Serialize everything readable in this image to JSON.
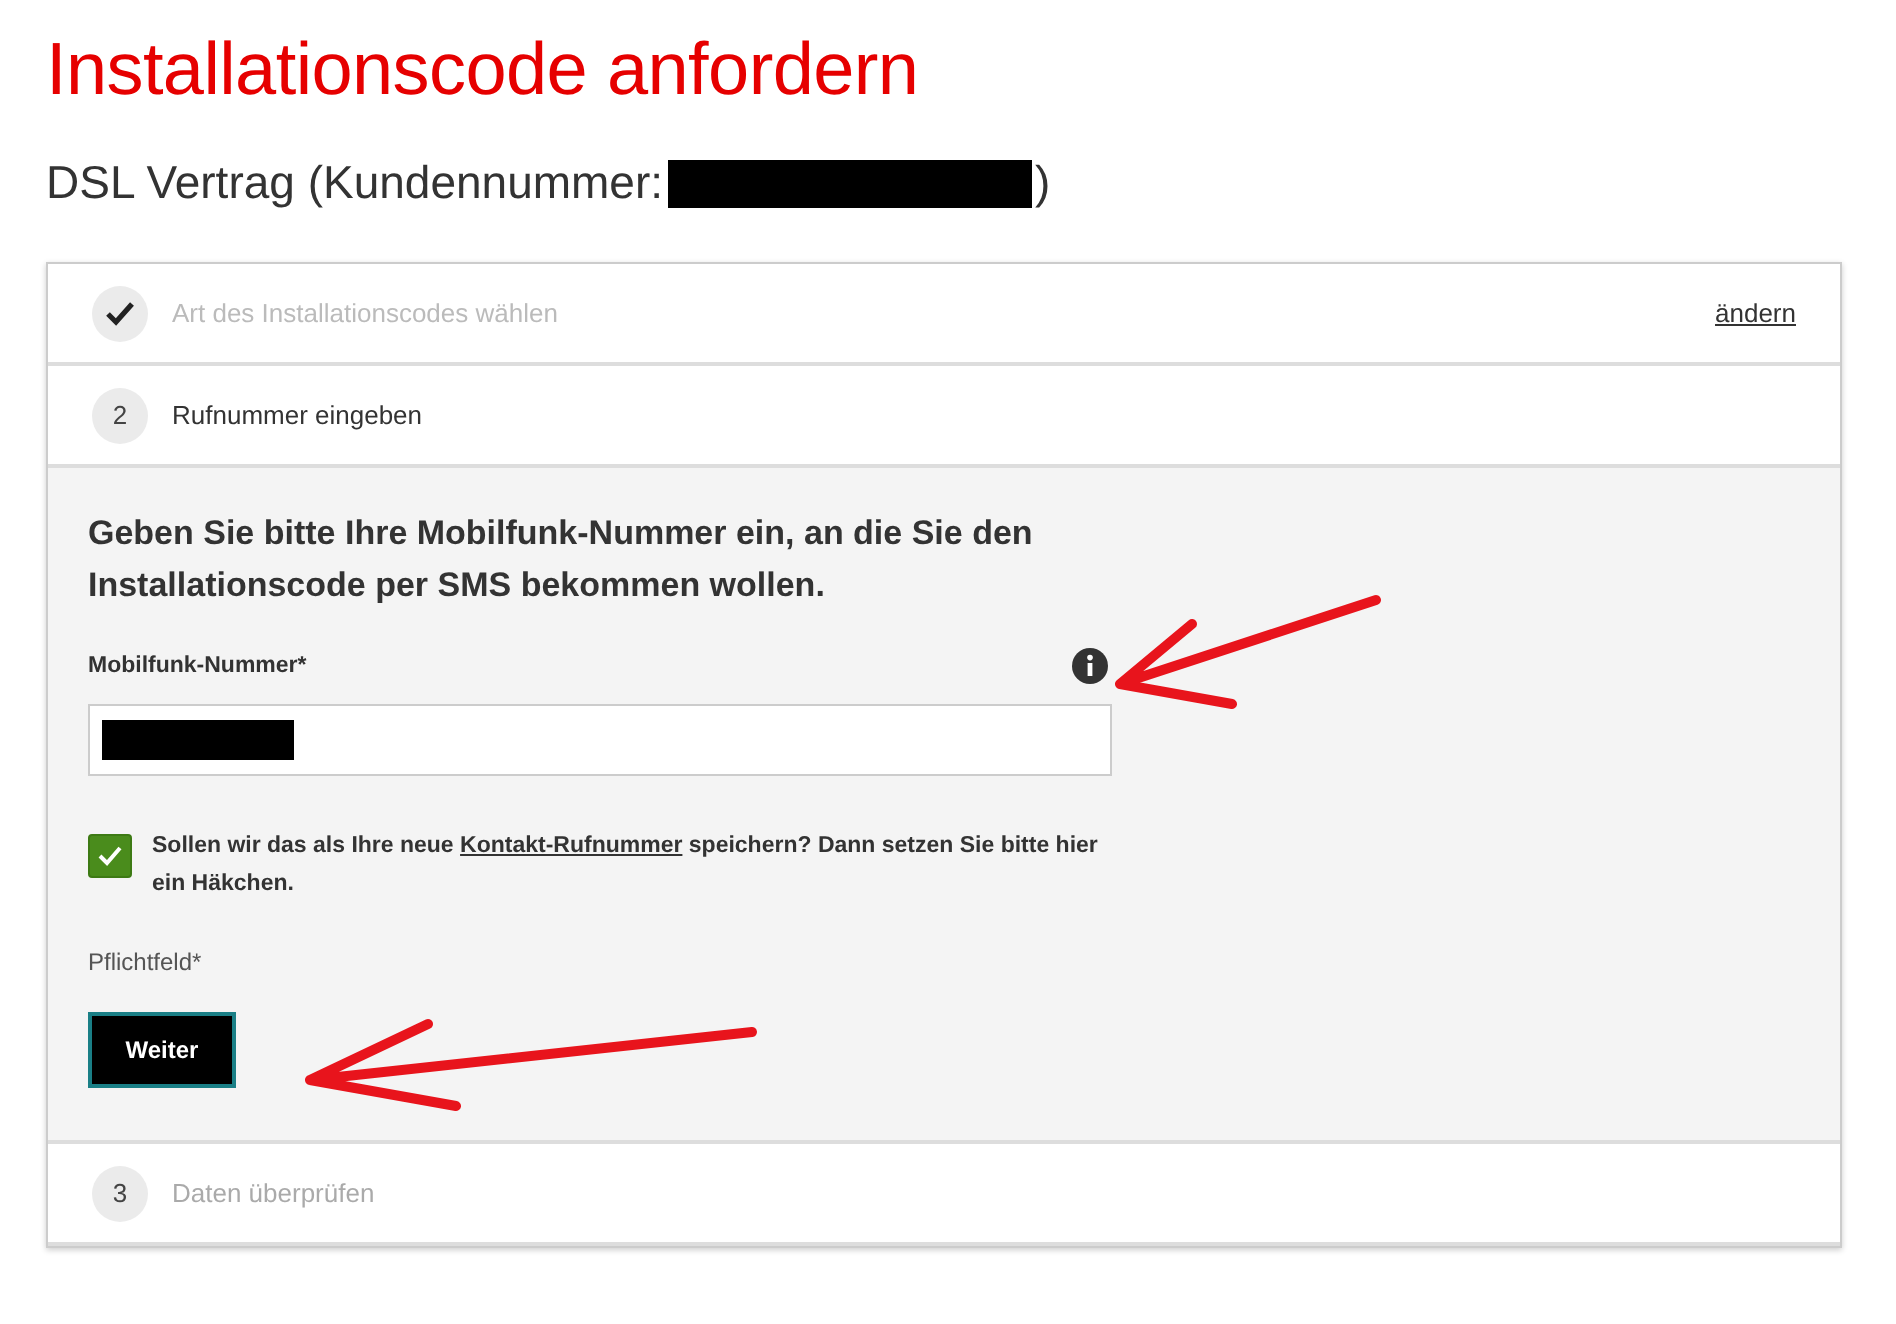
{
  "title": "Installationscode anfordern",
  "subtitle": {
    "text": "DSL Vertrag (Kundennummer:",
    "closing": ")",
    "redacted": true
  },
  "steps": [
    {
      "kind": "done",
      "label": "Art des Installationscodes wählen",
      "link": "ändern"
    },
    {
      "kind": "active",
      "number": "2",
      "label": "Rufnummer eingeben"
    },
    {
      "kind": "pending",
      "number": "3",
      "label": "Daten überprüfen"
    }
  ],
  "form": {
    "heading": "Geben Sie bitte Ihre Mobilfunk-Nummer ein, an die Sie den Installationscode per SMS bekommen wollen.",
    "field_label": "Mobilfunk-Nummer*",
    "field_redacted": true,
    "checkbox": {
      "checked": true,
      "before": "Sollen wir das als Ihre neue ",
      "link": "Kontakt-Rufnummer",
      "after": " speichern? Dann setzen Sie bitte hier ein Häkchen."
    },
    "required_note": "Pflichtfeld*",
    "button": "Weiter"
  }
}
